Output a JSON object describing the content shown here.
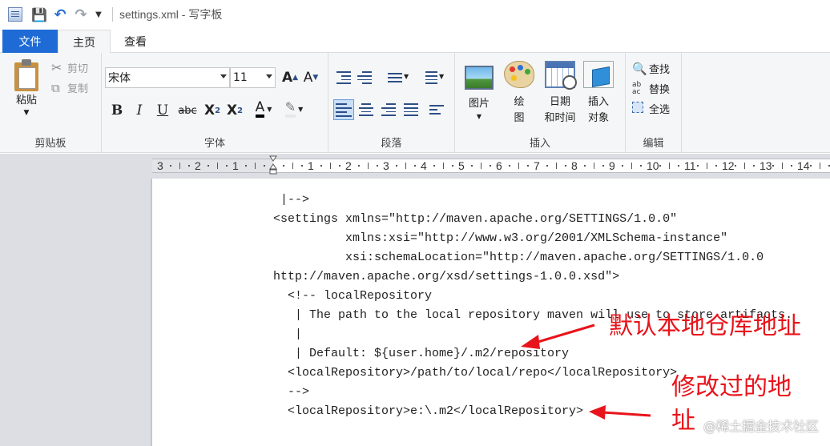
{
  "window": {
    "title": "settings.xml - 写字板",
    "quick_access": [
      "save-icon",
      "undo-icon",
      "redo-icon",
      "customize-icon"
    ]
  },
  "tabs": {
    "file": "文件",
    "home": "主页",
    "view": "查看"
  },
  "ribbon": {
    "clipboard": {
      "paste": "粘贴",
      "cut": "剪切",
      "copy": "复制",
      "label": "剪贴板"
    },
    "font": {
      "family": "宋体",
      "size": "11",
      "label": "字体",
      "buttons": {
        "grow": "A",
        "shrink": "A",
        "bold": "B",
        "italic": "I",
        "underline": "U",
        "strike": "abc",
        "subscript": "X",
        "superscript": "X",
        "sub_mark": "2",
        "sup_mark": "2",
        "color": "A"
      }
    },
    "paragraph": {
      "label": "段落"
    },
    "insert": {
      "label": "插入",
      "picture": "图片",
      "paint_1": "绘",
      "paint_2": "图",
      "datetime_1": "日期",
      "datetime_2": "和时间",
      "object_1": "插入",
      "object_2": "对象"
    },
    "editing": {
      "label": "编辑",
      "find": "查找",
      "replace": "替换",
      "select_all": "全选"
    }
  },
  "ruler": {
    "numbers": [
      "3",
      "2",
      "1",
      "1",
      "2",
      "3",
      "4",
      "5",
      "6",
      "7",
      "8",
      "9",
      "10",
      "11",
      "12",
      "13",
      "14"
    ]
  },
  "document": {
    "lines": [
      " |-->",
      "<settings xmlns=\"http://maven.apache.org/SETTINGS/1.0.0\"",
      "          xmlns:xsi=\"http://www.w3.org/2001/XMLSchema-instance\"",
      "          xsi:schemaLocation=\"http://maven.apache.org/SETTINGS/1.0.0",
      "http://maven.apache.org/xsd/settings-1.0.0.xsd\">",
      "  <!-- localRepository",
      "   | The path to the local repository maven will use to store artifacts.",
      "   |",
      "   | Default: ${user.home}/.m2/repository",
      "  <localRepository>/path/to/local/repo</localRepository>",
      "  -->",
      "  <localRepository>e:\\.m2</localRepository>"
    ]
  },
  "annotations": {
    "default_repo": "默认本地仓库地址",
    "modified_1": "修改过的地",
    "modified_2": "址",
    "color": "#e8141b"
  },
  "watermark": "@稀土掘金技术社区"
}
